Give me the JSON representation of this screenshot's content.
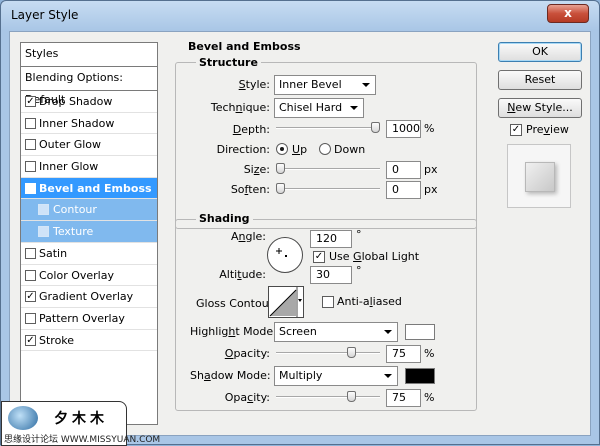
{
  "window": {
    "title": "Layer Style",
    "close_glyph": "x"
  },
  "styles_panel": {
    "header": "Styles",
    "blending": "Blending Options: Default",
    "items": [
      {
        "label": "Drop Shadow",
        "checked": true,
        "state": "normal"
      },
      {
        "label": "Inner Shadow",
        "checked": false,
        "state": "normal"
      },
      {
        "label": "Outer Glow",
        "checked": false,
        "state": "normal"
      },
      {
        "label": "Inner Glow",
        "checked": false,
        "state": "normal"
      },
      {
        "label": "Bevel and Emboss",
        "checked": true,
        "state": "active"
      },
      {
        "label": "Contour",
        "checked": false,
        "state": "sub"
      },
      {
        "label": "Texture",
        "checked": false,
        "state": "sub"
      },
      {
        "label": "Satin",
        "checked": false,
        "state": "normal"
      },
      {
        "label": "Color Overlay",
        "checked": false,
        "state": "normal"
      },
      {
        "label": "Gradient Overlay",
        "checked": true,
        "state": "normal"
      },
      {
        "label": "Pattern Overlay",
        "checked": false,
        "state": "normal"
      },
      {
        "label": "Stroke",
        "checked": true,
        "state": "normal"
      }
    ]
  },
  "bevel": {
    "section_title": "Bevel and Emboss",
    "structure": {
      "title": "Structure",
      "style_label": "Style:",
      "style_value": "Inner Bevel",
      "technique_label": "Technique:",
      "technique_value": "Chisel Hard",
      "depth_label": "Depth:",
      "depth_value": "1000",
      "depth_unit": "%",
      "depth_level": 1.0,
      "direction_label": "Direction:",
      "direction_up": "Up",
      "direction_down": "Down",
      "direction_selected": "Up",
      "size_label": "Size:",
      "size_value": "0",
      "size_unit": "px",
      "size_level": 0.0,
      "soften_label": "Soften:",
      "soften_value": "0",
      "soften_unit": "px",
      "soften_level": 0.0
    },
    "shading": {
      "title": "Shading",
      "angle_label": "Angle:",
      "angle_value": "120",
      "angle_unit": "°",
      "use_global_light": "Use Global Light",
      "use_global_light_checked": true,
      "altitude_label": "Altitude:",
      "altitude_value": "30",
      "altitude_unit": "°",
      "gloss_label": "Gloss Contour:",
      "anti_aliased": "Anti-aliased",
      "anti_aliased_checked": false,
      "highlight_label": "Highlight Mode:",
      "highlight_value": "Screen",
      "highlight_color": "#ffffff",
      "highlight_opacity_label": "Opacity:",
      "highlight_opacity_value": "75",
      "highlight_opacity_level": 0.75,
      "opacity_unit": "%",
      "shadow_label": "Shadow Mode:",
      "shadow_value": "Multiply",
      "shadow_color": "#000000",
      "shadow_opacity_label": "Opacity:",
      "shadow_opacity_value": "75",
      "shadow_opacity_level": 0.75
    }
  },
  "buttons": {
    "ok": "OK",
    "reset": "Reset",
    "new_style": "New Style...",
    "preview": "Preview",
    "preview_checked": true
  },
  "watermark": {
    "brand": "夕木木",
    "url": "思缘设计论坛 WWW.MISSYUAN.COM"
  }
}
